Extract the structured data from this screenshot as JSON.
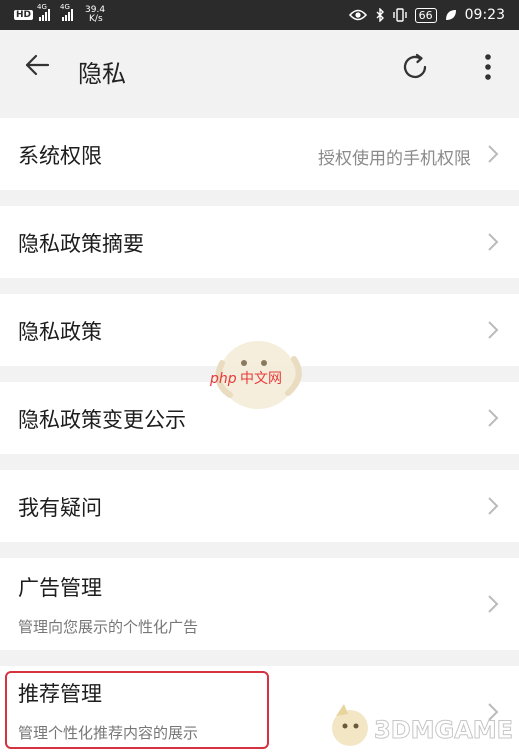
{
  "status_bar": {
    "hd": "HD",
    "signal1_tag": "4G",
    "signal2_tag": "4G",
    "speed_value": "39.4",
    "speed_unit": "K/s",
    "battery": "66",
    "time": "09:23"
  },
  "header": {
    "title": "隐私"
  },
  "items": [
    {
      "label": "系统权限",
      "value": "授权使用的手机权限"
    },
    {
      "label": "隐私政策摘要"
    },
    {
      "label": "隐私政策"
    },
    {
      "label": "隐私政策变更公示"
    },
    {
      "label": "我有疑问"
    },
    {
      "label": "广告管理",
      "sub": "管理向您展示的个性化广告"
    },
    {
      "label": "推荐管理",
      "sub": "管理个性化推荐内容的展示"
    }
  ],
  "watermarks": {
    "php": "php中文网",
    "site": "3DMGAME"
  },
  "colors": {
    "highlight": "#d4333f",
    "background": "#f2f2f2",
    "status_bar": "#2b2b2b"
  },
  "icons": [
    "back-arrow-icon",
    "refresh-icon",
    "more-vert-icon",
    "chevron-right-icon",
    "eye-icon",
    "bluetooth-icon",
    "vibrate-icon",
    "leaf-icon"
  ]
}
